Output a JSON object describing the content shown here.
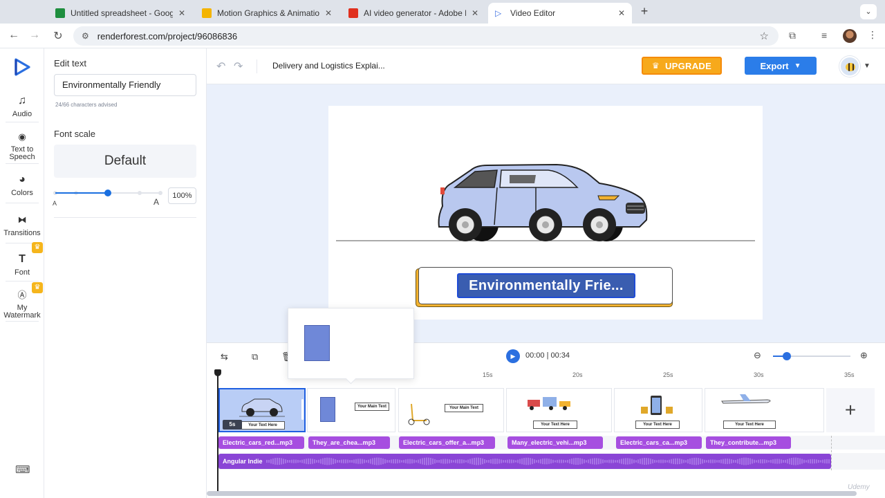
{
  "browser": {
    "tabs": [
      {
        "label": "Untitled spreadsheet - Googl",
        "favicon_color": "#1e8e3e"
      },
      {
        "label": "Motion Graphics & Animation",
        "favicon_color": "#f4b400"
      },
      {
        "label": "AI video generator - Adobe Fi",
        "favicon_color": "#e0301e"
      },
      {
        "label": "Video Editor",
        "favicon_color": "#3b6fe0",
        "active": true
      }
    ],
    "close_glyph": "✕",
    "new_tab": "+",
    "url": "renderforest.com/project/96086836"
  },
  "rail": {
    "items": [
      {
        "label": "Audio",
        "icon": "music-note-icon"
      },
      {
        "label": "Text to Speech",
        "icon": "speech-icon"
      },
      {
        "label": "Colors",
        "icon": "palette-icon"
      },
      {
        "label": "Transitions",
        "icon": "transition-icon"
      },
      {
        "label": "Font",
        "icon": "font-icon",
        "premium": true
      },
      {
        "label": "My Watermark",
        "icon": "watermark-icon",
        "premium": true
      }
    ]
  },
  "panel": {
    "edit_text_heading": "Edit text",
    "text_value": "Environmentally Friendly",
    "char_advice": "24/66  characters advised",
    "font_scale_heading": "Font scale",
    "font_scale_value": "Default",
    "slider_fraction": 0.5,
    "slider_small_label": "A",
    "slider_large_label": "A",
    "scale_percent": "100%"
  },
  "header": {
    "project_title": "Delivery and Logistics Explai...",
    "upgrade_label": "UPGRADE",
    "export_label": "Export",
    "accent_upgrade": "#f7a91b",
    "accent_export": "#2b7de9"
  },
  "stage": {
    "caption_text": "Environmentally Frie...",
    "car_color": "#b9c8ef"
  },
  "timeline": {
    "current_time": "00:00",
    "total_time": "00:34",
    "time_separator": "|",
    "zoom_fraction": 0.18,
    "ruler": [
      "15s",
      "20s",
      "25s",
      "30s",
      "35s"
    ],
    "selected_scene_duration": "5s",
    "scenes": [
      {
        "placard": "Your Text Here"
      },
      {
        "placard": "Your Main Text"
      },
      {
        "placard": "Your Main Text"
      },
      {
        "placard": "Your Text Here"
      },
      {
        "placard": "Your Text Here"
      },
      {
        "placard": "Your Text Here"
      }
    ],
    "audio_clips": [
      "Electric_cars_red...mp3",
      "They_are_chea...mp3",
      "Electric_cars_offer_a...mp3",
      "Many_electric_vehi...mp3",
      "Electric_cars_ca...mp3",
      "They_contribute...mp3"
    ],
    "music_track": "Angular Indie",
    "add_scene": "+"
  },
  "watermark": "Udemy"
}
